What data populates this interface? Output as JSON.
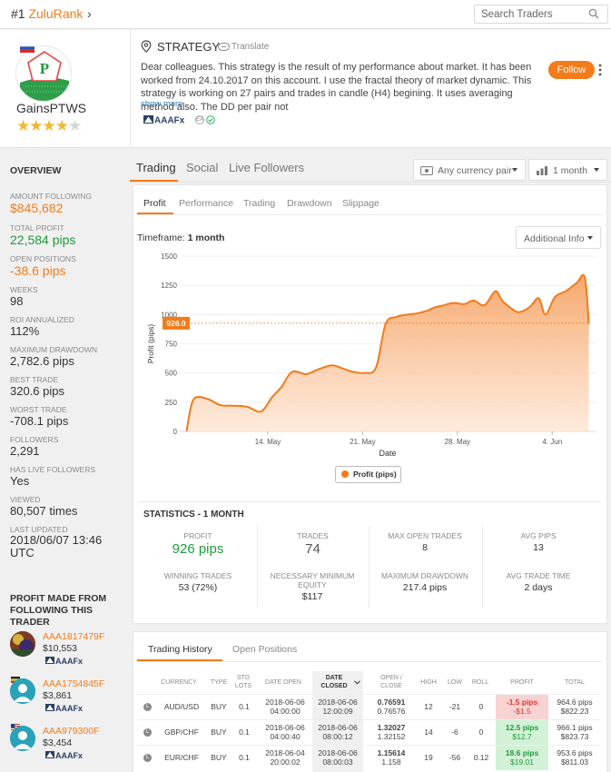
{
  "topbar": {
    "rank_prefix": "#1",
    "brand": "ZuluRank",
    "search_placeholder": "Search Traders"
  },
  "profile": {
    "username": "GainsPTWS",
    "avatar_letter": "P",
    "rating": 4,
    "rating_max": 5,
    "strategy_title": "STRATEGY",
    "translate_label": "Translate",
    "description": "Dear colleagues. This strategy is the result of my performance about market. It has been worked from 24.10.2017 on this account. I use the fractal theory of market dynamic. This strategy is working on 27 pairs and trades in candle (H4) begining. It uses averaging method also. The DD per pair not",
    "show_more": "show more",
    "broker": "AAAFx",
    "ea_badge": "EA",
    "follow_label": "Follow"
  },
  "overview": {
    "title": "OVERVIEW",
    "items": [
      {
        "label": "AMOUNT FOLLOWING",
        "value": "$845,682"
      },
      {
        "label": "TOTAL PROFIT",
        "value": "22,584 pips"
      },
      {
        "label": "OPEN POSITIONS",
        "value": "-38.6 pips"
      },
      {
        "label": "WEEKS",
        "value": "98"
      },
      {
        "label": "ROI ANNUALIZED",
        "value": "112%"
      },
      {
        "label": "MAXIMUM DRAWDOWN",
        "value": "2,782.6 pips"
      },
      {
        "label": "BEST TRADE",
        "value": "320.6 pips"
      },
      {
        "label": "WORST TRADE",
        "value": "-708.1 pips"
      },
      {
        "label": "FOLLOWERS",
        "value": "2,291"
      },
      {
        "label": "HAS LIVE FOLLOWERS",
        "value": "Yes"
      },
      {
        "label": "VIEWED",
        "value": "80,507 times"
      },
      {
        "label": "LAST UPDATED",
        "value": "2018/06/07 13:46 UTC"
      }
    ],
    "profit_made_title": "PROFIT MADE FROM FOLLOWING THIS TRADER",
    "followers": [
      {
        "name": "AAA1817479F",
        "amount": "$10,553",
        "broker": "AAAFx"
      },
      {
        "name": "AAA1754845F",
        "amount": "$3,861",
        "broker": "AAAFx"
      },
      {
        "name": "AAA979300F",
        "amount": "$3,454",
        "broker": "AAAFx"
      }
    ]
  },
  "tabs": {
    "main": [
      "Trading",
      "Social",
      "Live Followers"
    ],
    "currency_dd": "Any currency pair",
    "period_dd": "1 month",
    "sub": [
      "Profit",
      "Performance",
      "Trading",
      "Drawdown",
      "Slippage"
    ],
    "timeframe_label": "Timeframe:",
    "timeframe_value": "1 month",
    "additional_info": "Additional Info"
  },
  "chart_data": {
    "type": "area",
    "xlabel": "Date",
    "ylabel": "Profit (pips)",
    "ylim": [
      0,
      1500
    ],
    "yticks": [
      0,
      250,
      500,
      750,
      1000,
      1250,
      1500
    ],
    "xticks": [
      {
        "day": 14,
        "label": "14. May"
      },
      {
        "day": 21,
        "label": "21. May"
      },
      {
        "day": 28,
        "label": "28. May"
      },
      {
        "day": 35,
        "label": "4. Jun"
      }
    ],
    "reference_line": 926.0,
    "reference_label": "926.0",
    "series": [
      {
        "name": "Profit (pips)",
        "color": "#f27b1a",
        "x": [
          8,
          8.5,
          9.5,
          10.5,
          11.5,
          12.5,
          13.5,
          14.3,
          15,
          15.8,
          16.8,
          17.5,
          18.2,
          18.8,
          19.5,
          20.3,
          21.2,
          22,
          22.7,
          23.5,
          24.3,
          25,
          25.7,
          26.3,
          27,
          27.7,
          28.5,
          29.2,
          30,
          30.8,
          31.3,
          31.9,
          32.5,
          33.3,
          34,
          34.5,
          35.2,
          36,
          36.8,
          37.4,
          37.7
        ],
        "y": [
          0,
          270,
          280,
          225,
          220,
          210,
          170,
          290,
          380,
          510,
          490,
          520,
          550,
          565,
          540,
          510,
          500,
          550,
          920,
          980,
          1000,
          1010,
          1030,
          1060,
          1080,
          1100,
          1090,
          1120,
          1080,
          1200,
          1120,
          1060,
          1020,
          1060,
          1140,
          1000,
          1150,
          1200,
          1270,
          1320,
          920
        ]
      }
    ]
  },
  "statistics": {
    "title": "STATISTICS - 1 MONTH",
    "row1": [
      {
        "label": "PROFIT",
        "value": "926 pips"
      },
      {
        "label": "TRADES",
        "value": "74"
      },
      {
        "label": "MAX OPEN TRADES",
        "value": "8"
      },
      {
        "label": "AVG PIPS",
        "value": "13"
      }
    ],
    "row2": [
      {
        "label": "WINNING TRADES",
        "value": "53 (72%)"
      },
      {
        "label": "NECESSARY MINIMUM EQUITY",
        "value": "$117"
      },
      {
        "label": "MAXIMUM DRAWDOWN",
        "value": "217.4 pips"
      },
      {
        "label": "AVG TRADE TIME",
        "value": "2 days"
      }
    ]
  },
  "history": {
    "tabs": [
      "Trading History",
      "Open Positions"
    ],
    "columns": [
      "CURRENCY",
      "TYPE",
      "STD LOTS",
      "DATE OPEN",
      "DATE CLOSED",
      "OPEN / CLOSE",
      "HIGH",
      "LOW",
      "ROLL",
      "PROFIT",
      "TOTAL"
    ],
    "rows": [
      {
        "badge": "L",
        "currency": "AUD/USD",
        "type": "BUY",
        "lots": "0.1",
        "open_date": "2018-06-06",
        "open_time": "04:00:00",
        "close_date": "2018-06-06",
        "close_time": "12:00:09",
        "open_price": "0.76591",
        "close_price": "0.76576",
        "high": "12",
        "low": "-21",
        "roll": "0",
        "profit_pips": "-1.5 pips",
        "profit_usd": "-$1.5",
        "total_pips": "964.6 pips",
        "total_usd": "$822.23",
        "sign": "loss"
      },
      {
        "badge": "L",
        "currency": "GBP/CHF",
        "type": "BUY",
        "lots": "0.1",
        "open_date": "2018-06-06",
        "open_time": "04:00:40",
        "close_date": "2018-06-06",
        "close_time": "08:00:12",
        "open_price": "1.32027",
        "close_price": "1.32152",
        "high": "14",
        "low": "-6",
        "roll": "0",
        "profit_pips": "12.5 pips",
        "profit_usd": "$12.7",
        "total_pips": "966.1 pips",
        "total_usd": "$823.73",
        "sign": "gain"
      },
      {
        "badge": "L",
        "currency": "EUR/CHF",
        "type": "BUY",
        "lots": "0.1",
        "open_date": "2018-06-04",
        "open_time": "20:00:02",
        "close_date": "2018-06-06",
        "close_time": "08:00:03",
        "open_price": "1.15614",
        "close_price": "1.158",
        "high": "19",
        "low": "-56",
        "roll": "0.12",
        "profit_pips": "18.6 pips",
        "profit_usd": "$19.01",
        "total_pips": "953.6 pips",
        "total_usd": "$811.03",
        "sign": "gain"
      }
    ]
  }
}
